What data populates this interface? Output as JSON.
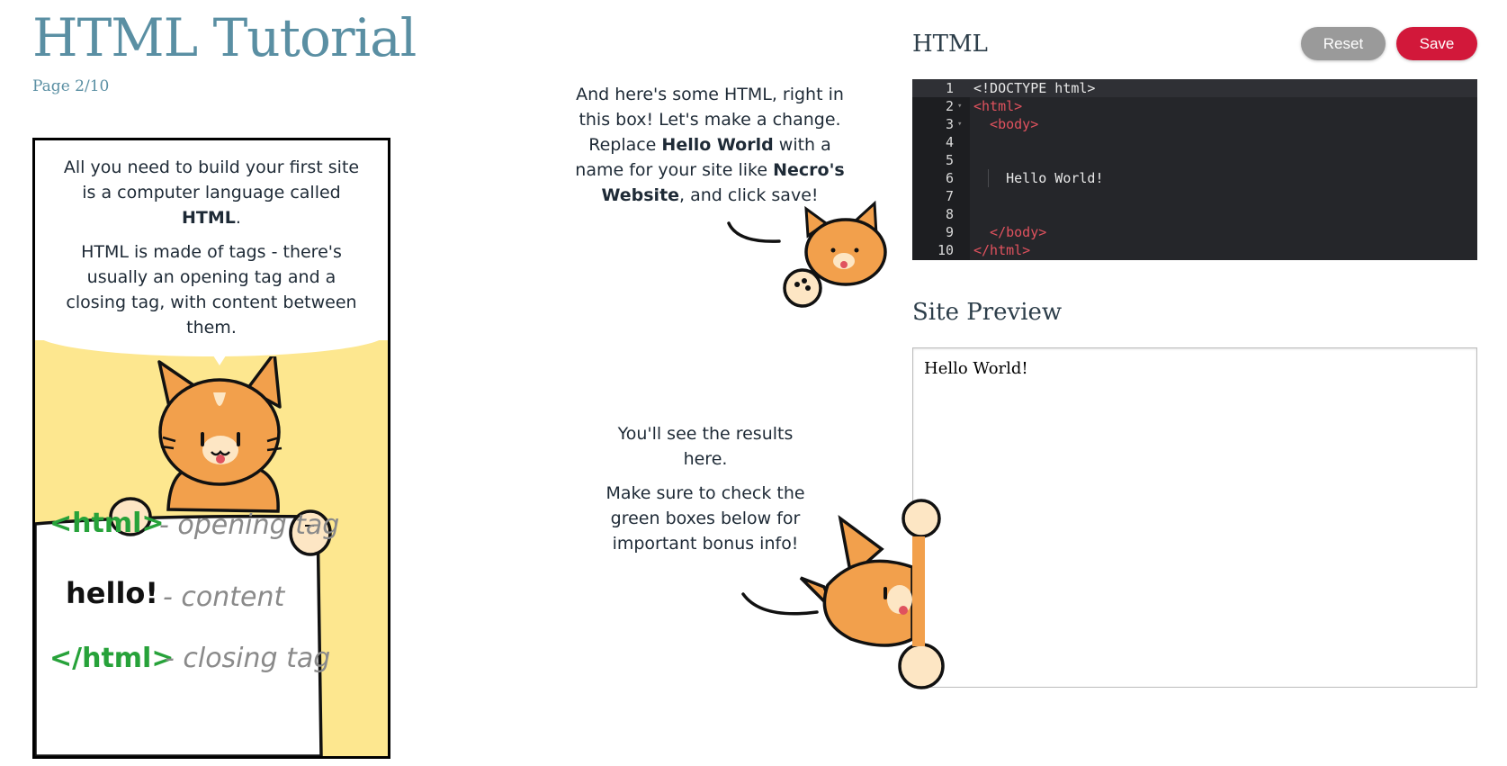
{
  "header": {
    "title": "HTML Tutorial",
    "page_indicator": "Page 2/10"
  },
  "comic": {
    "line1_a": "All you need to build your first site is a computer language called ",
    "line1_bold": "HTML",
    "line1_b": ".",
    "line2": "HTML is made of tags - there's usually an opening tag and a closing tag, with content between them.",
    "sign": {
      "opening_tag": "<html>",
      "opening_note": "- opening tag",
      "content": "hello!",
      "content_note": "- content",
      "closing_tag": "</html>",
      "closing_note": "- closing tag"
    }
  },
  "speech_top": {
    "part1": "And here's some HTML, right in this box! Let's make a change. Replace ",
    "bold1": "Hello World",
    "part2": " with a name for your site like ",
    "bold2": "Necro's Website",
    "part3": ", and click save!"
  },
  "speech_bottom": {
    "line1": "You'll see the results here.",
    "line2": "Make sure to check the green boxes below for important bonus info!"
  },
  "editor": {
    "heading": "HTML",
    "reset_label": "Reset",
    "save_label": "Save",
    "lines": [
      {
        "num": "1",
        "text": "<!DOCTYPE html>"
      },
      {
        "num": "2",
        "text": "<html>"
      },
      {
        "num": "3",
        "text": "  <body>"
      },
      {
        "num": "4",
        "text": ""
      },
      {
        "num": "5",
        "text": ""
      },
      {
        "num": "6",
        "text": "    Hello World!"
      },
      {
        "num": "7",
        "text": ""
      },
      {
        "num": "8",
        "text": ""
      },
      {
        "num": "9",
        "text": "  </body>"
      },
      {
        "num": "10",
        "text": "</html>"
      }
    ]
  },
  "preview": {
    "heading": "Site Preview",
    "content": "Hello World!"
  },
  "colors": {
    "title": "#5a8fa3",
    "save_button": "#d2183a",
    "reset_button": "#9a9a9a",
    "editor_bg": "#25262a",
    "tag_color": "#e0525e",
    "comic_yellow": "#fde78f",
    "cat_orange": "#f2a04c"
  }
}
